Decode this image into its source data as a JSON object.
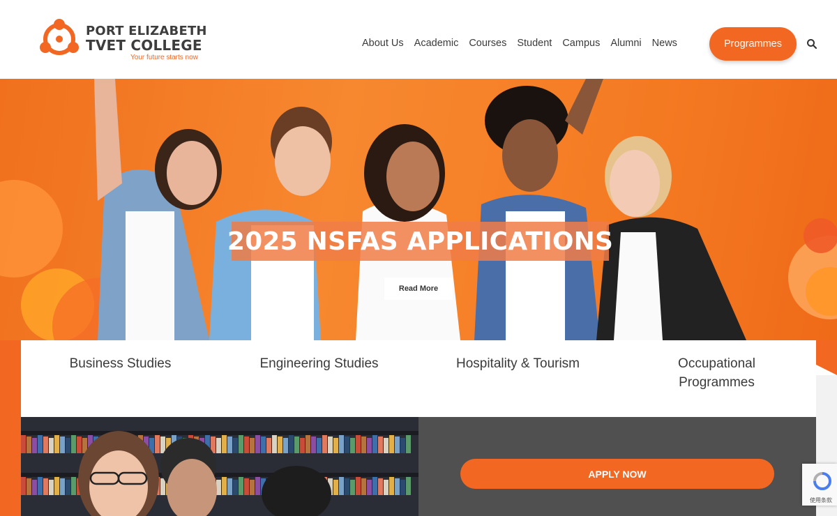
{
  "brand": {
    "line1": "PORT ELIZABETH",
    "line2": "TVET COLLEGE",
    "tagline": "Your future starts now",
    "accent": "#f26722"
  },
  "nav": {
    "items": [
      "About Us",
      "Academic",
      "Courses",
      "Student",
      "Campus",
      "Alumni",
      "News"
    ],
    "cta": "Programmes",
    "search_icon": "search-icon"
  },
  "hero": {
    "title": "2025 NSFAS APPLICATIONS",
    "button": "Read More"
  },
  "categories": [
    "Business Studies",
    "Engineering Studies",
    "Hospitality & Tourism",
    "Occupational Programmes"
  ],
  "apply": {
    "button": "APPLY NOW"
  },
  "recaptcha": {
    "icon": "recaptcha-icon",
    "text": "使用条款"
  }
}
